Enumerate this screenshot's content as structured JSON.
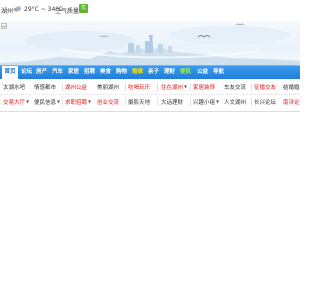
{
  "weather": {
    "city": "湖州",
    "icon": "cloud-icon",
    "temperature": "29°C ~ 34°C",
    "aqi_label": "空气质量:",
    "aqi_value": "优",
    "aqi_color": "#5fb530"
  },
  "banner": {
    "broken_image_icon": "broken-image-icon"
  },
  "nav": {
    "accent": "#2a8ae6",
    "items": [
      {
        "label": "首页"
      },
      {
        "label": "论坛"
      },
      {
        "label": "房产"
      },
      {
        "label": "汽车"
      },
      {
        "label": "家居"
      },
      {
        "label": "招聘"
      },
      {
        "label": "美食"
      },
      {
        "label": "购物"
      },
      {
        "label": "婚嫁"
      },
      {
        "label": "亲子"
      },
      {
        "label": "理财"
      },
      {
        "label": "便民"
      },
      {
        "label": "公益"
      },
      {
        "label": "导航"
      }
    ]
  },
  "subnav": {
    "row1": [
      {
        "label": "太湖水吧",
        "color": "#333333"
      },
      {
        "label": "情感都市",
        "color": "#333333"
      },
      {
        "label": "湖州公益",
        "color": "#e01818"
      },
      {
        "label": "美丽湖州",
        "color": "#333333"
      },
      {
        "label": "吃喝玩乐",
        "color": "#e01818"
      },
      {
        "label": "住在湖州",
        "color": "#e01818"
      },
      {
        "label": "家居装饰",
        "color": "#e01818"
      },
      {
        "label": "车友交流",
        "color": "#333333"
      },
      {
        "label": "征婚交友",
        "color": "#e01818"
      },
      {
        "label": "结婚婚",
        "color": "#333333"
      }
    ],
    "row2": [
      {
        "label": "交易大厅",
        "color": "#e01818"
      },
      {
        "label": "便民信息",
        "color": "#333333"
      },
      {
        "label": "求职招聘",
        "color": "#e01818"
      },
      {
        "label": "创业交流",
        "color": "#e01818"
      },
      {
        "label": "摄影天地",
        "color": "#333333"
      },
      {
        "label": "大话理财",
        "color": "#333333"
      },
      {
        "label": "兴趣小组",
        "color": "#333333"
      },
      {
        "label": "人文湖州",
        "color": "#333333"
      },
      {
        "label": "长兴论坛",
        "color": "#333333"
      },
      {
        "label": "南浔论",
        "color": "#e01818"
      }
    ]
  }
}
